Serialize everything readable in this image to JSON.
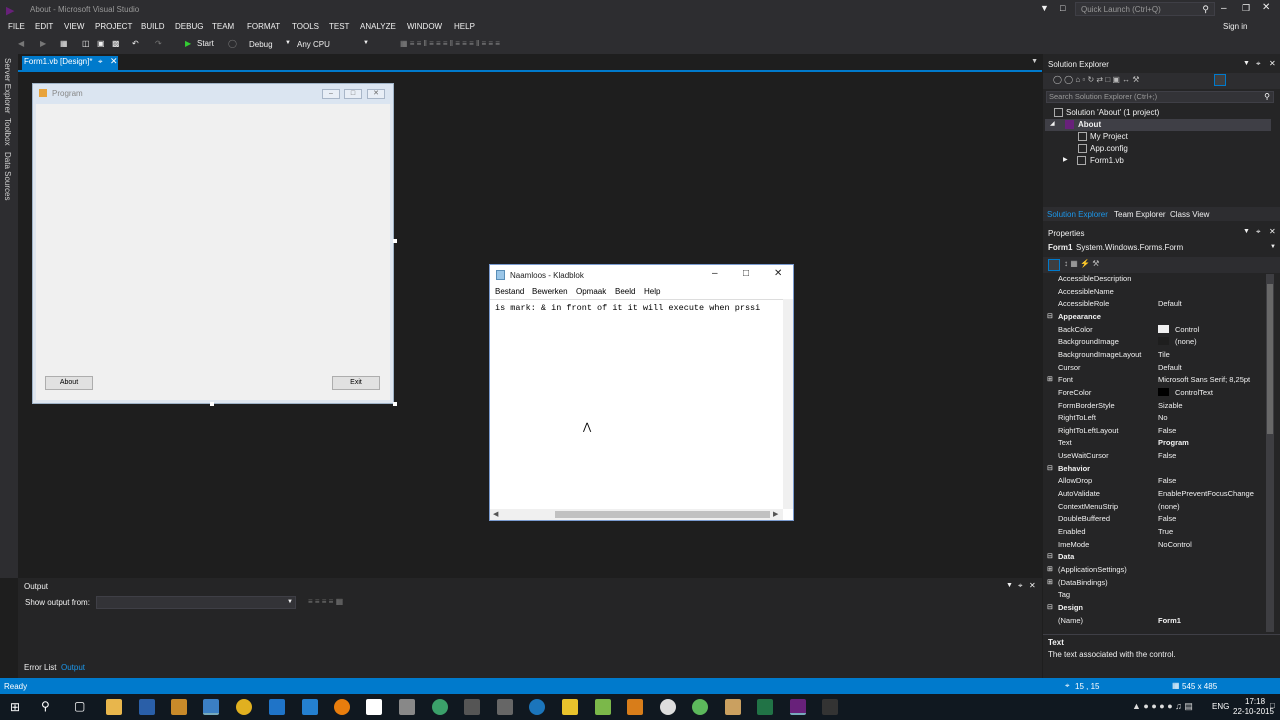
{
  "window": {
    "title": "About - Microsoft Visual Studio",
    "quick_launch": "Quick Launch (Ctrl+Q)",
    "sign_in": "Sign in"
  },
  "menu": [
    "FILE",
    "EDIT",
    "VIEW",
    "PROJECT",
    "BUILD",
    "DEBUG",
    "TEAM",
    "FORMAT",
    "TOOLS",
    "TEST",
    "ANALYZE",
    "WINDOW",
    "HELP"
  ],
  "toolbar": {
    "start": "Start",
    "config": "Debug",
    "platform": "Any CPU"
  },
  "left_tabs": [
    "Server Explorer",
    "Toolbox",
    "Data Sources"
  ],
  "doc_tab": {
    "label": "Form1.vb [Design]*"
  },
  "designer_form": {
    "title": "Program",
    "about_button": "About",
    "exit_button": "Exit"
  },
  "notepad": {
    "title": "Naamloos - Kladblok",
    "menu": [
      "Bestand",
      "Bewerken",
      "Opmaak",
      "Beeld",
      "Help"
    ],
    "text": "is mark: & in front of it it will execute when prssi"
  },
  "solution_explorer": {
    "title": "Solution Explorer",
    "search_placeholder": "Search Solution Explorer (Ctrl+;)",
    "items": [
      "Solution 'About' (1 project)",
      "About",
      "My Project",
      "App.config",
      "Form1.vb"
    ],
    "tabs": [
      "Solution Explorer",
      "Team Explorer",
      "Class View"
    ]
  },
  "properties": {
    "title": "Properties",
    "object_name": "Form1",
    "object_type": "System.Windows.Forms.Form",
    "rows": [
      {
        "name": "AccessibleDescription",
        "value": ""
      },
      {
        "name": "AccessibleName",
        "value": ""
      },
      {
        "name": "AccessibleRole",
        "value": "Default"
      },
      {
        "name": "Appearance",
        "value": "",
        "category": true
      },
      {
        "name": "BackColor",
        "value": "Control",
        "swatch": "#f0f0f0"
      },
      {
        "name": "BackgroundImage",
        "value": "(none)",
        "swatch": "#1e1e1e"
      },
      {
        "name": "BackgroundImageLayout",
        "value": "Tile"
      },
      {
        "name": "Cursor",
        "value": "Default"
      },
      {
        "name": "Font",
        "value": "Microsoft Sans Serif; 8,25pt",
        "expander": "+"
      },
      {
        "name": "ForeColor",
        "value": "ControlText",
        "swatch": "#000000"
      },
      {
        "name": "FormBorderStyle",
        "value": "Sizable"
      },
      {
        "name": "RightToLeft",
        "value": "No"
      },
      {
        "name": "RightToLeftLayout",
        "value": "False"
      },
      {
        "name": "Text",
        "value": "Program",
        "bold": true
      },
      {
        "name": "UseWaitCursor",
        "value": "False"
      },
      {
        "name": "Behavior",
        "value": "",
        "category": true
      },
      {
        "name": "AllowDrop",
        "value": "False"
      },
      {
        "name": "AutoValidate",
        "value": "EnablePreventFocusChange"
      },
      {
        "name": "ContextMenuStrip",
        "value": "(none)"
      },
      {
        "name": "DoubleBuffered",
        "value": "False"
      },
      {
        "name": "Enabled",
        "value": "True"
      },
      {
        "name": "ImeMode",
        "value": "NoControl"
      },
      {
        "name": "Data",
        "value": "",
        "category": true
      },
      {
        "name": "(ApplicationSettings)",
        "value": "",
        "expander": "+"
      },
      {
        "name": "(DataBindings)",
        "value": "",
        "expander": "+"
      },
      {
        "name": "Tag",
        "value": ""
      },
      {
        "name": "Design",
        "value": "",
        "category": true
      },
      {
        "name": "(Name)",
        "value": "Form1",
        "bold": true
      }
    ],
    "desc_title": "Text",
    "desc_body": "The text associated with the control."
  },
  "output": {
    "title": "Output",
    "show_from": "Show output from:",
    "tabs": [
      "Error List",
      "Output"
    ]
  },
  "status": {
    "left": "Ready",
    "pos": "15 , 15",
    "size": "545 x 485"
  },
  "taskbar": {
    "lang": "ENG",
    "time": "17:18",
    "date": "22-10-2015"
  },
  "colors": {
    "accent": "#007acc",
    "vs_dark": "#2d2d30",
    "editor": "#1e1e1e"
  }
}
